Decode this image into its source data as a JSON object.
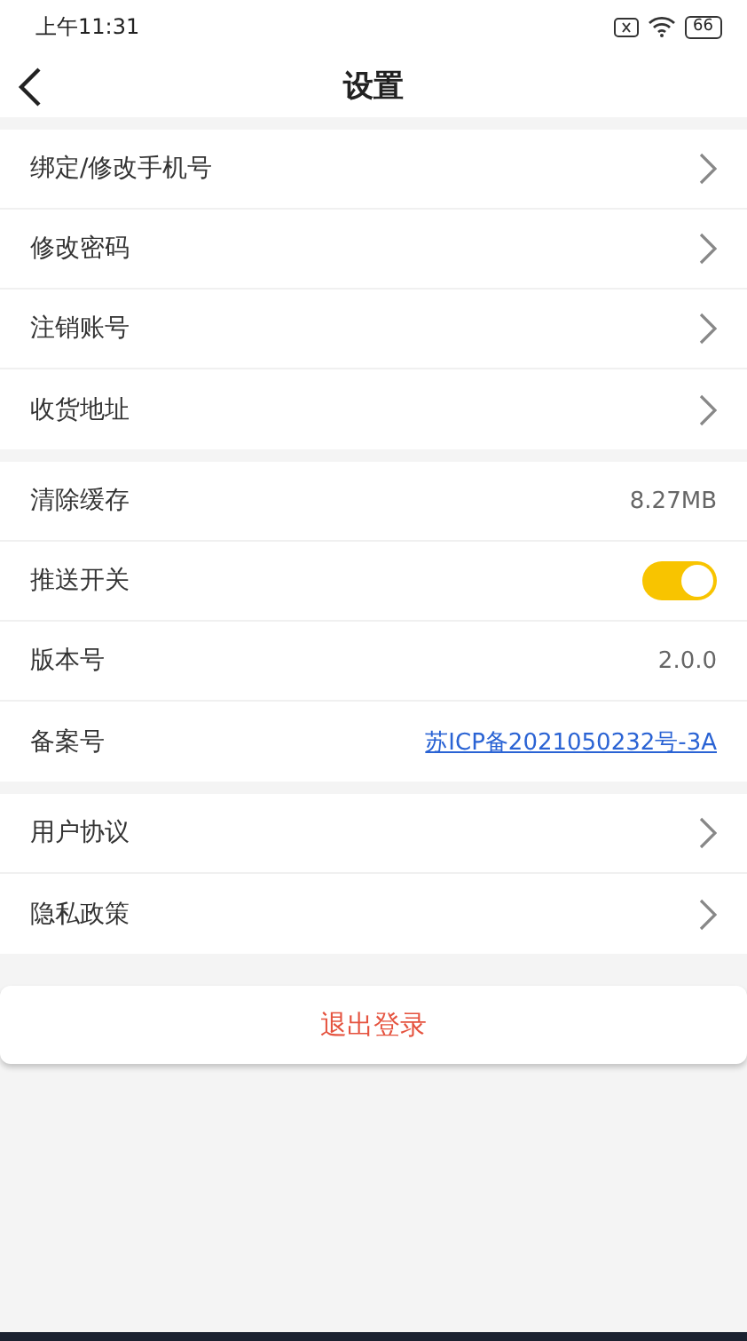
{
  "status_bar": {
    "time": "上午11:31",
    "battery": "66"
  },
  "header": {
    "title": "设置"
  },
  "groups": [
    {
      "rows": [
        {
          "kind": "link",
          "label": "绑定/修改手机号"
        },
        {
          "kind": "link",
          "label": "修改密码"
        },
        {
          "kind": "link",
          "label": "注销账号"
        },
        {
          "kind": "link",
          "label": "收货地址"
        }
      ]
    },
    {
      "rows": [
        {
          "kind": "value",
          "label": "清除缓存",
          "value": "8.27MB"
        },
        {
          "kind": "toggle",
          "label": "推送开关",
          "on": true
        },
        {
          "kind": "value",
          "label": "版本号",
          "value": "2.0.0"
        },
        {
          "kind": "hyperlink",
          "label": "备案号",
          "value": "苏ICP备2021050232号-3A"
        }
      ]
    },
    {
      "rows": [
        {
          "kind": "link",
          "label": "用户协议"
        },
        {
          "kind": "link",
          "label": "隐私政策"
        }
      ]
    }
  ],
  "logout_button": "退出登录"
}
